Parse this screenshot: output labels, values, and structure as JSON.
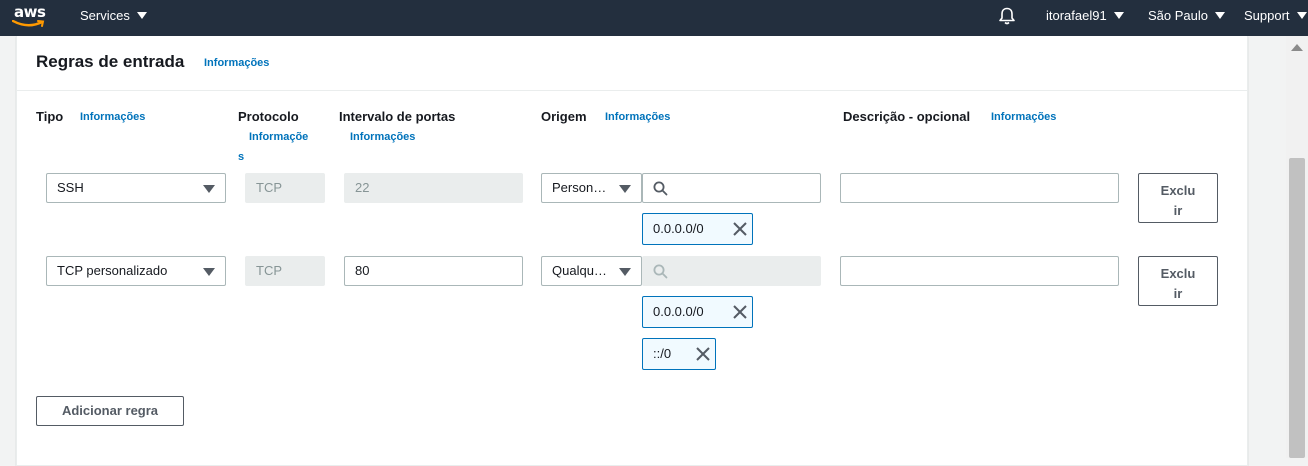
{
  "nav": {
    "logo": "aws",
    "services": "Services",
    "user": "itorafael91",
    "region": "São Paulo",
    "support": "Support"
  },
  "section": {
    "title": "Regras de entrada",
    "info": "Informações"
  },
  "columns": {
    "tipo": "Tipo",
    "tipo_info": "Informações",
    "protocolo": "Protocolo",
    "protocolo_info_1": "Informaçõe",
    "protocolo_info_2": "s",
    "portas": "Intervalo de portas",
    "portas_info": "Informações",
    "origem": "Origem",
    "origem_info": "Informações",
    "descricao": "Descrição - opcional",
    "descricao_info": "Informações"
  },
  "rules": [
    {
      "tipo": "SSH",
      "protocolo": "TCP",
      "portas": "22",
      "origem": "Person…",
      "tokens": [
        "0.0.0.0/0"
      ],
      "delete_1": "Exclu",
      "delete_2": "ir"
    },
    {
      "tipo": "TCP personalizado",
      "protocolo": "TCP",
      "portas": "80",
      "origem": "Qualqu…",
      "tokens": [
        "0.0.0.0/0",
        "::/0"
      ],
      "delete_1": "Exclu",
      "delete_2": "ir"
    }
  ],
  "add_rule": "Adicionar regra",
  "colors": {
    "nav_bg": "#232f3e",
    "link": "#0073bb",
    "token_bg": "#f1faff"
  }
}
